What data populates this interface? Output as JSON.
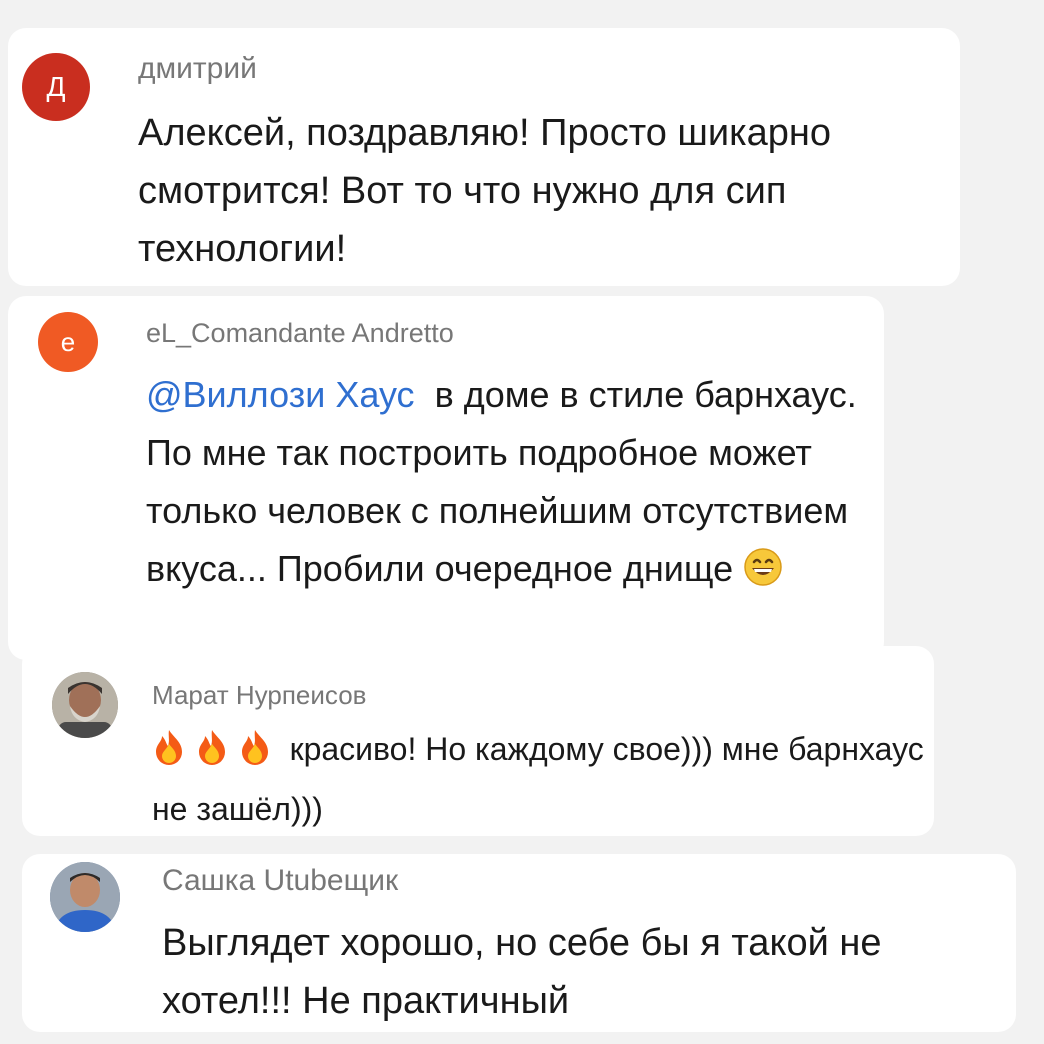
{
  "comments": [
    {
      "author": "дмитрий",
      "avatar_letter": "Д",
      "avatar_color": "#c92e1f",
      "text": "Алексей, поздравляю! Просто шикарно смотрится! Вот то что нужно для сип технологии!"
    },
    {
      "author": "eL_Comandante Andretto",
      "avatar_letter": "e",
      "avatar_color": "#f05a24",
      "mention": "@Виллози Хаус",
      "text": "в доме в стиле барнхаус. По мне так построить подробное может только человек с полнейшим отсутствием вкуса... Пробили очередное днище",
      "emoji": "grinning-face"
    },
    {
      "author": "Марат Нурпеисов",
      "avatar_type": "photo",
      "emoji": [
        "fire",
        "fire",
        "fire"
      ],
      "text": "красиво! Но каждому свое))) мне барнхаус не зашёл)))"
    },
    {
      "author": "Сашка Utubещик",
      "avatar_type": "photo",
      "text": "Выглядет хорошо, но себе бы я такой не хотел!!! Не практичный"
    }
  ]
}
